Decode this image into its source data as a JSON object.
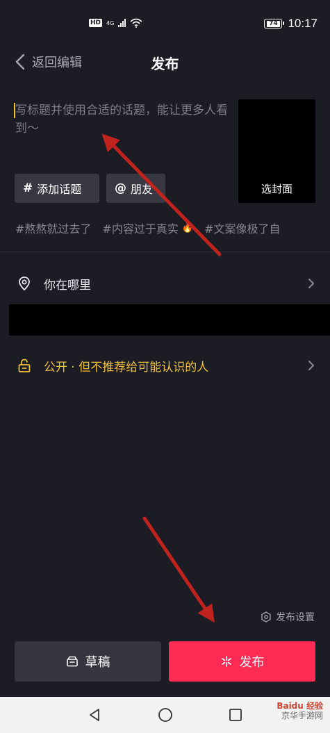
{
  "status_bar": {
    "hd": "HD",
    "network": "4G",
    "battery": "74",
    "time": "10:17"
  },
  "header": {
    "back_label": "返回编辑",
    "title": "发布"
  },
  "caption": {
    "placeholder": "写标题并使用合适的话题，能让更多人看到～"
  },
  "cover": {
    "label": "选封面"
  },
  "chips": {
    "add_topic": "添加话题",
    "friends": "朋友"
  },
  "hashtags": [
    "#熬熬就过去了",
    "#内容过于真实",
    "#文案像极了自"
  ],
  "location": {
    "label": "你在哪里"
  },
  "privacy": {
    "label": "公开 · 但不推荐给可能认识的人"
  },
  "publish_settings": {
    "label": "发布设置"
  },
  "buttons": {
    "draft": "草稿",
    "publish": "发布"
  },
  "watermark": {
    "brand": "Baidu 经验",
    "site": "京华手游网"
  },
  "colors": {
    "background": "#1c1c25",
    "chip": "#383842",
    "publish_button": "#fe2c55",
    "privacy_accent": "#f0c23b",
    "annotation_arrow": "#c0231e"
  },
  "icons": {
    "back": "chevron-left-icon",
    "hashtag": "hashtag-icon",
    "at": "at-icon",
    "location": "location-pin-icon",
    "lock": "unlock-icon",
    "chevron": "chevron-right-icon",
    "settings": "hexagon-gear-icon",
    "draft": "draft-box-icon",
    "publish": "sparkle-icon"
  }
}
